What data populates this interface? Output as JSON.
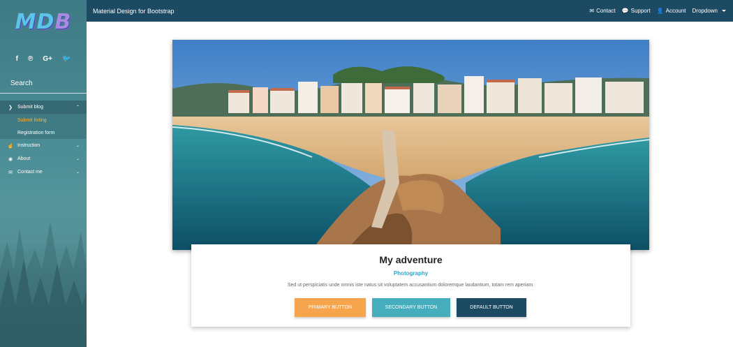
{
  "sidebar": {
    "logo": {
      "m": "M",
      "d": "D",
      "b": "B"
    },
    "social": [
      {
        "icon": "facebook-icon",
        "glyph": "f"
      },
      {
        "icon": "pinterest-icon",
        "glyph": "℗"
      },
      {
        "icon": "google-plus-icon",
        "glyph": "G+"
      },
      {
        "icon": "twitter-icon",
        "glyph": "🐦"
      }
    ],
    "search_label": "Search",
    "menu": {
      "submit_blog": "Submit blog",
      "submit_listing": "Submit listing",
      "registration_form": "Registration form",
      "instruction": "Instruction",
      "about": "About",
      "contact_me": "Contact me"
    }
  },
  "topnav": {
    "brand": "Material Design for Bootstrap",
    "contact": "Contact",
    "support": "Support",
    "account": "Account",
    "dropdown": "Dropdown"
  },
  "card": {
    "title": "My adventure",
    "subtitle": "Photography",
    "text": "Sed ut perspiciatis unde omnis iste natus sit voluptatem accusantium doloremque laudantium, totam rem aperiam.",
    "primary_button": "PRIMARY BUTTON",
    "secondary_button": "SECONDARY BUTTON",
    "default_button": "DEFAULT BUTTON"
  },
  "colors": {
    "navbar": "#1c4a63",
    "primary": "#f6a54d",
    "secondary": "#46adbc",
    "default": "#1c4a63",
    "accent_text": "#30a5c8",
    "active_sub_item": "#f5b546"
  }
}
